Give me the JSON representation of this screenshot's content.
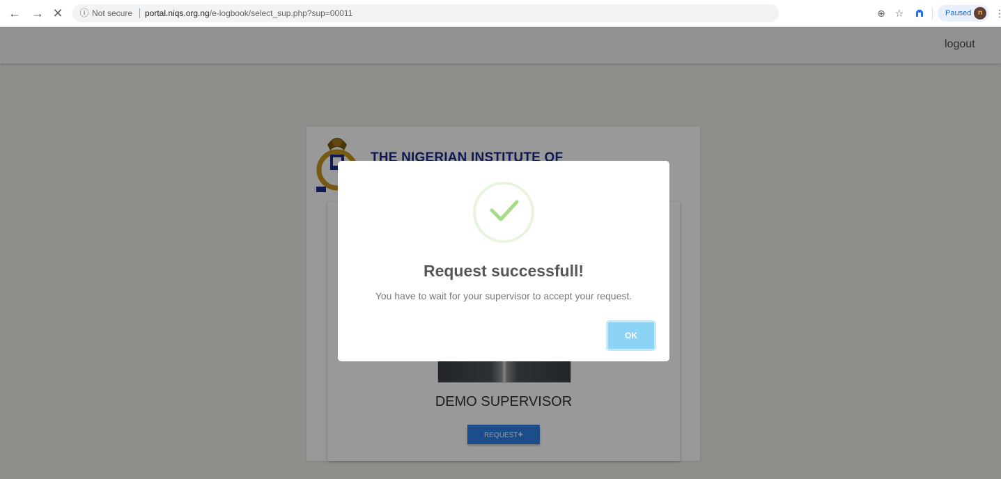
{
  "browser": {
    "back_icon": "arrow-left-icon",
    "forward_icon": "arrow-right-icon",
    "stop_icon": "close-icon",
    "security_label": "Not secure",
    "url_host": "portal.niqs.org.ng",
    "url_path": "/e-logbook/select_sup.php?sup=00011",
    "zoom_icon": "zoom-icon",
    "bookmark_icon": "star-icon",
    "extension_icon": "extension-icon",
    "profile_label": "Paused",
    "profile_initial": "n",
    "menu_icon": "kebab-menu-icon"
  },
  "header": {
    "logout_label": "logout"
  },
  "institute": {
    "name": "THE NIGERIAN INSTITUTE OF"
  },
  "supervisor": {
    "name": "DEMO SUPERVISOR",
    "request_label": "REQUEST",
    "request_icon": "+"
  },
  "modal": {
    "icon": "checkmark-icon",
    "title": "Request successfull!",
    "text": "You have to wait for your supervisor to accept your request.",
    "ok_label": "OK"
  },
  "colors": {
    "ok_button": "#8cd4f5",
    "success_check": "#a5dc86",
    "request_button": "#2f7fe6",
    "institute_name": "#1d2a8a"
  }
}
